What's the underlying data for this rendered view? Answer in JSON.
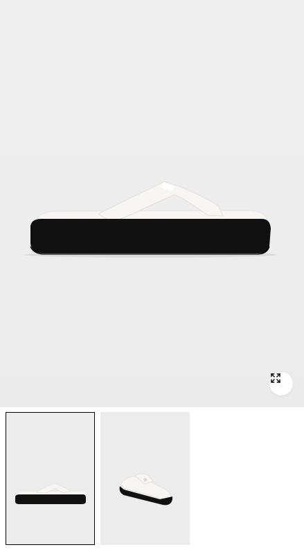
{
  "gallery": {
    "main_image": {
      "icon": "flip-flop-platform-sandal-side-view",
      "colors": {
        "strap": "#f7f6f2",
        "sole": "#111111",
        "background": "#eeeeee"
      }
    },
    "expand_button": {
      "icon": "expand-arrows-icon"
    },
    "thumbnails": [
      {
        "icon": "sandal-side-view",
        "selected": true
      },
      {
        "icon": "sandal-three-quarter-view",
        "selected": false
      }
    ]
  }
}
